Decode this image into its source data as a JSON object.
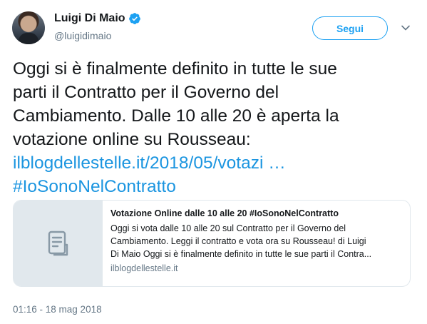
{
  "author": {
    "display_name": "Luigi Di Maio",
    "handle": "@luigidimaio",
    "verified": true
  },
  "actions": {
    "follow_label": "Segui",
    "menu_icon": "chevron-down-icon"
  },
  "tweet": {
    "lines": [
      "Oggi si è finalmente definito in tutte le sue",
      "parti il Contratto per il Governo del",
      "Cambiamento. Dalle 10 alle 20 è aperta la",
      "votazione online su Rousseau:"
    ],
    "link_text": "ilblogdellestelle.it/2018/05/votazi …",
    "hashtag": "#IoSonoNelContratto"
  },
  "card": {
    "title": "Votazione Online dalle 10 alle 20 #IoSonoNelContratto",
    "description_lines": [
      "Oggi si vota dalle 10 alle 20 sul Contratto per il Governo del",
      "Cambiamento. Leggi il contratto e vota ora su Rousseau! di Luigi",
      "Di Maio Oggi si è finalmente definito in tutte le sue parti il Contra..."
    ],
    "domain": "ilblogdellestelle.it",
    "thumbnail_icon": "document-icon"
  },
  "timestamp": "01:16 - 18 mag 2018",
  "colors": {
    "accent": "#1da1f2",
    "link": "#1b95e0",
    "secondary_text": "#657786",
    "border": "#e1e8ed"
  }
}
